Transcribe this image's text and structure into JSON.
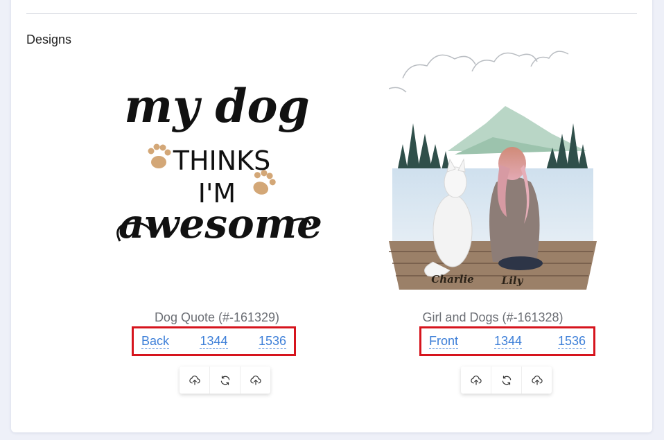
{
  "section": {
    "title": "Designs"
  },
  "designs": [
    {
      "name": "Dog Quote (#-161329)",
      "side": "Back",
      "width": "1344",
      "height": "1536",
      "art": {
        "line1": "my dog",
        "line2": "THINKS",
        "line3": "I'M",
        "line4": "awesome"
      }
    },
    {
      "name": "Girl and Dogs (#-161328)",
      "side": "Front",
      "width": "1344",
      "height": "1536",
      "art": {
        "pet_name": "Charlie",
        "person_name": "Lily"
      }
    }
  ],
  "icons": {
    "upload": "cloud-upload-icon",
    "refresh": "refresh-icon",
    "upload_alt": "cloud-upload-icon"
  },
  "colors": {
    "link": "#3d7fd8",
    "highlight_border": "#d6141d",
    "paw": "#d3a777"
  }
}
